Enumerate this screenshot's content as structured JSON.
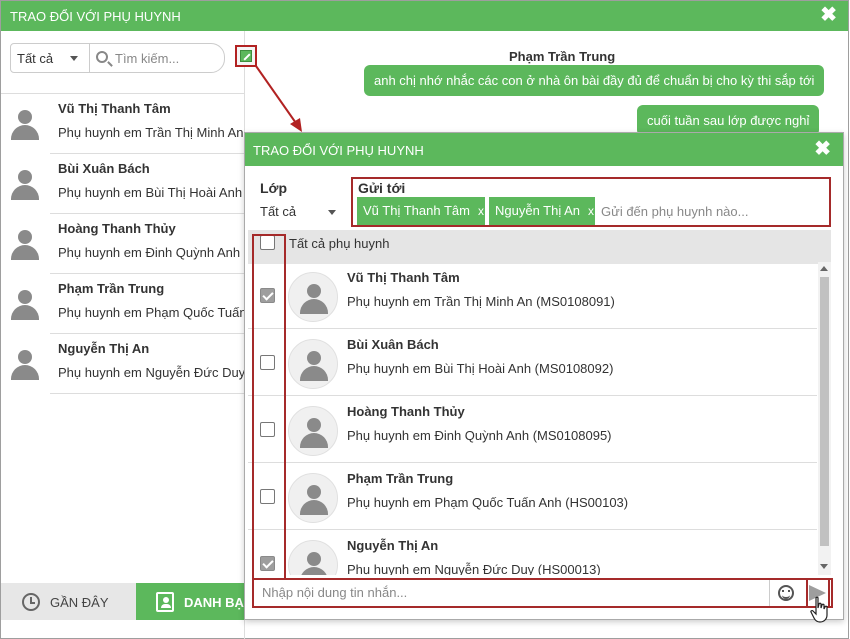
{
  "main_window": {
    "title": "TRAO ĐỔI VỚI PHỤ HUYNH",
    "close": "✖",
    "filter_value": "Tất cả",
    "search_placeholder": "Tìm kiếm...",
    "contacts": [
      {
        "name": "Vũ Thị Thanh Tâm",
        "sub": "Phụ huynh em Trần Thị Minh An"
      },
      {
        "name": "Bùi Xuân Bách",
        "sub": "Phụ huynh em Bùi Thị Hoài Anh"
      },
      {
        "name": "Hoàng Thanh Thủy",
        "sub": "Phụ huynh em Đinh Quỳnh Anh"
      },
      {
        "name": "Phạm Trần Trung",
        "sub": "Phụ huynh em Phạm Quốc Tuấn"
      },
      {
        "name": "Nguyễn Thị An",
        "sub": "Phụ huynh em Nguyễn Đức Duy"
      }
    ],
    "tabs": {
      "recent": "GẦN ĐÂY",
      "contacts": "DANH BẠ"
    },
    "chat": {
      "contact_name": "Phạm Trần Trung",
      "messages": [
        "anh chị nhớ nhắc các con ở nhà ôn bài đầy đủ để chuẩn bị cho kỳ thi sắp tới",
        "cuối tuần sau lớp được nghỉ"
      ]
    }
  },
  "dialog": {
    "title": "TRAO ĐỔI VỚI PHỤ HUYNH",
    "close": "✖",
    "class_label": "Lớp",
    "class_value": "Tất cả",
    "sendto_label": "Gửi tới",
    "chips": [
      {
        "label": "Vũ Thị Thanh Tâm",
        "remove": "x"
      },
      {
        "label": "Nguyễn Thị An",
        "remove": "x"
      }
    ],
    "sendto_placeholder": "Gửi đến phụ huynh nào...",
    "select_all_label": "Tất cả phụ huynh",
    "parents": [
      {
        "name": "Vũ Thị Thanh Tâm",
        "sub": "Phụ huynh em Trần Thị Minh An (MS0108091)",
        "checked": true
      },
      {
        "name": "Bùi Xuân Bách",
        "sub": "Phụ huynh em Bùi Thị Hoài Anh (MS0108092)",
        "checked": false
      },
      {
        "name": "Hoàng Thanh Thủy",
        "sub": "Phụ huynh em Đinh Quỳnh Anh (MS0108095)",
        "checked": false
      },
      {
        "name": "Phạm Trần Trung",
        "sub": "Phụ huynh em Phạm Quốc Tuấn Anh (HS00103)",
        "checked": false
      },
      {
        "name": "Nguyễn Thị An",
        "sub": "Phụ huynh em Nguyễn Đức Duy (HS00013)",
        "checked": true
      }
    ],
    "message_placeholder": "Nhập nội dung tin nhắn..."
  },
  "colors": {
    "accent": "#5cb85c",
    "highlight": "#a52a2a"
  },
  "icons": [
    "search-icon",
    "compose-icon",
    "close-icon",
    "clock-icon",
    "contact-book-icon",
    "user-icon",
    "emoji-icon",
    "send-icon",
    "hand-cursor-icon"
  ]
}
